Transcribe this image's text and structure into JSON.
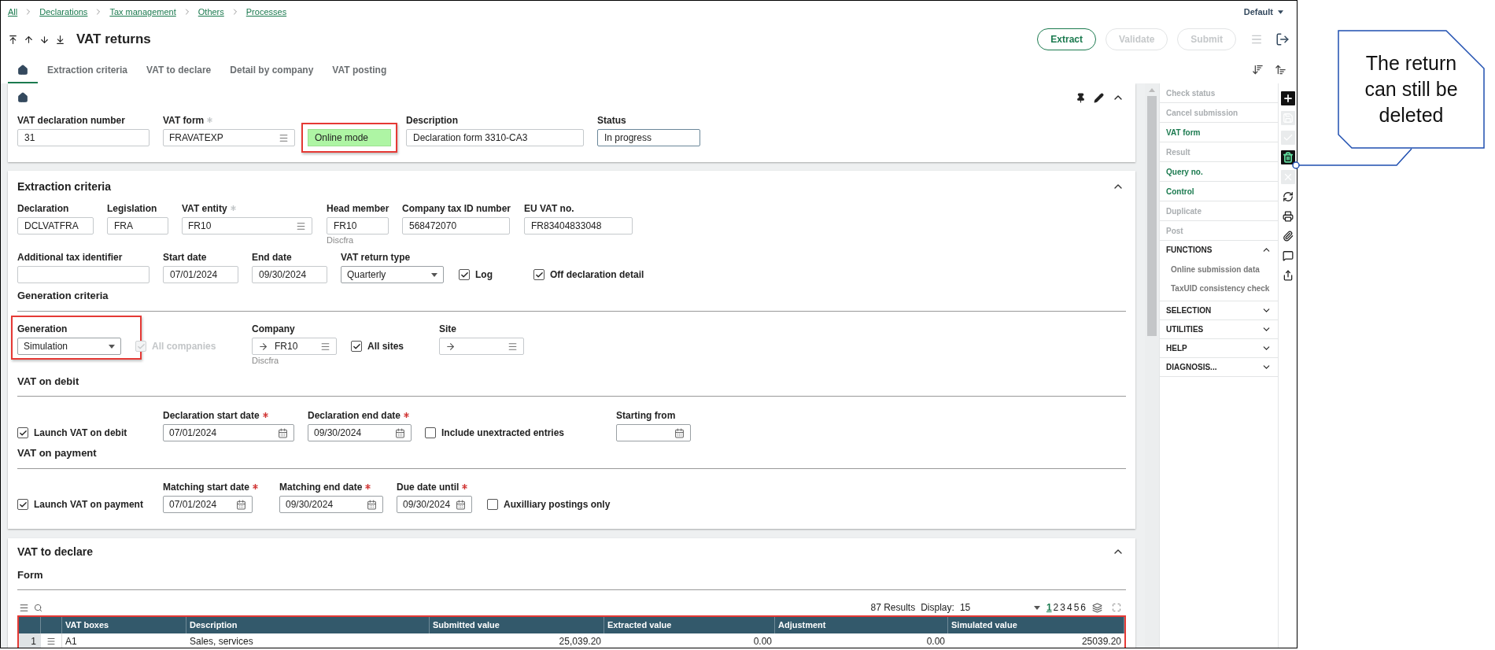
{
  "breadcrumb": [
    "All",
    "Declarations",
    "Tax management",
    "Others",
    "Processes"
  ],
  "view_selector": "Default",
  "title": "VAT returns",
  "actions": [
    {
      "label": "Extract",
      "disabled": false
    },
    {
      "label": "Validate",
      "disabled": true
    },
    {
      "label": "Submit",
      "disabled": true
    }
  ],
  "tabs": [
    {
      "kind": "home",
      "selected": true
    },
    {
      "kind": "text",
      "label": "Extraction criteria",
      "selected": false
    },
    {
      "kind": "text",
      "label": "VAT to declare",
      "selected": false
    },
    {
      "kind": "text",
      "label": "Detail by company",
      "selected": false
    },
    {
      "kind": "text",
      "label": "VAT posting",
      "selected": false
    }
  ],
  "header_fields": [
    {
      "kind": "text",
      "label": "VAT declaration number",
      "value": "31"
    },
    {
      "kind": "lookup",
      "label": "VAT form",
      "required": true,
      "star_muted": true,
      "value": "FRAVATEXP"
    },
    {
      "kind": "badge",
      "value": "Online mode",
      "highlighted": true
    },
    {
      "kind": "text",
      "label": "Description",
      "value": "Declaration form 3310-CA3"
    },
    {
      "kind": "status",
      "label": "Status",
      "value": "In progress"
    }
  ],
  "extraction": {
    "title": "Extraction criteria",
    "rows": [
      {
        "fields": [
          {
            "kind": "text",
            "label": "Declaration",
            "value": "DCLVATFRA"
          },
          {
            "kind": "text",
            "label": "Legislation",
            "value": "FRA"
          },
          {
            "kind": "lookup",
            "label": "VAT entity",
            "required": true,
            "star_muted": true,
            "value": "FR10"
          },
          {
            "kind": "text",
            "label": "Head member",
            "value": "FR10",
            "sub": "Discfra"
          },
          {
            "kind": "text",
            "label": "Company tax ID number",
            "value": "568472070"
          },
          {
            "kind": "text",
            "label": "EU VAT no.",
            "value": "FR83404833048"
          }
        ]
      },
      {
        "fields": [
          {
            "kind": "text",
            "label": "Additional tax identifier"
          },
          {
            "kind": "text",
            "label": "Start date",
            "value": "07/01/2024"
          },
          {
            "kind": "text",
            "label": "End date",
            "value": "09/30/2024"
          },
          {
            "kind": "select",
            "label": "VAT return type",
            "value": "Quarterly"
          },
          {
            "kind": "checkbox",
            "label": "Log",
            "checked": true,
            "disabled": false
          },
          {
            "kind": "checkbox",
            "label": "Off declaration detail",
            "checked": true,
            "disabled": false
          }
        ]
      }
    ],
    "sections": [
      {
        "title": "Generation criteria",
        "fields": [
          {
            "kind": "select",
            "label": "Generation",
            "value": "Simulation",
            "highlighted": true
          },
          {
            "kind": "checkbox",
            "label": "All companies",
            "checked": true,
            "disabled": true
          },
          {
            "kind": "lookup",
            "label": "Company",
            "arrow": true,
            "value": "FR10",
            "sub": "Discfra"
          },
          {
            "kind": "checkbox",
            "label": "All sites",
            "checked": true,
            "disabled": false
          },
          {
            "kind": "lookup",
            "label": "Site",
            "arrow": true
          }
        ]
      },
      {
        "title": "VAT on debit",
        "fields": [
          {
            "kind": "checkbox",
            "label": "Launch VAT on debit",
            "checked": true,
            "disabled": false
          },
          {
            "kind": "date",
            "label": "Declaration start date",
            "required": true,
            "star_muted": false,
            "value": "07/01/2024"
          },
          {
            "kind": "date",
            "label": "Declaration end date",
            "required": true,
            "star_muted": false,
            "value": "09/30/2024"
          },
          {
            "kind": "checkbox",
            "label": "Include unextracted entries",
            "checked": false,
            "disabled": false
          },
          {
            "kind": "date",
            "label": "Starting from"
          }
        ]
      },
      {
        "title": "VAT on payment",
        "fields": [
          {
            "kind": "checkbox",
            "label": "Launch VAT on payment",
            "checked": true,
            "disabled": false
          },
          {
            "kind": "date",
            "label": "Matching start date",
            "required": true,
            "star_muted": false,
            "value": "07/01/2024"
          },
          {
            "kind": "date",
            "label": "Matching end date",
            "required": true,
            "star_muted": false,
            "value": "09/30/2024"
          },
          {
            "kind": "date",
            "label": "Due date until",
            "required": true,
            "star_muted": false,
            "value": "09/30/2024"
          },
          {
            "kind": "checkbox",
            "label": "Auxilliary postings only",
            "checked": false,
            "disabled": false
          }
        ]
      }
    ]
  },
  "vat_to_declare": {
    "title": "VAT to declare",
    "subtitle": "Form",
    "results": "87 Results",
    "display_label": "Display:",
    "display_value": "15",
    "pages": [
      {
        "label": "1",
        "selected": true
      },
      {
        "label": "2",
        "selected": false
      },
      {
        "label": "3",
        "selected": false
      },
      {
        "label": "4",
        "selected": false
      },
      {
        "label": "5",
        "selected": false
      },
      {
        "label": "6",
        "selected": false
      }
    ],
    "table": {
      "highlighted": true,
      "columns": [
        "VAT boxes",
        "Description",
        "Submitted value",
        "Extracted value",
        "Adjustment",
        "Simulated value"
      ],
      "rows": [
        {
          "number": "1",
          "cells": [
            "A1",
            "Sales, services",
            "25,039.20",
            "0.00",
            "0.00",
            "25039.20"
          ]
        }
      ]
    }
  },
  "sidebar": {
    "actions": [
      {
        "label": "Check status",
        "disabled": true
      },
      {
        "label": "Cancel submission",
        "disabled": true
      },
      {
        "label": "VAT form",
        "disabled": false
      },
      {
        "label": "Result",
        "disabled": true
      },
      {
        "label": "Query no.",
        "disabled": false
      },
      {
        "label": "Control",
        "disabled": false
      },
      {
        "label": "Duplicate",
        "disabled": true
      },
      {
        "label": "Post",
        "disabled": true
      }
    ],
    "sections": [
      {
        "label": "FUNCTIONS",
        "expanded": true,
        "children": [
          {
            "label": "Online submission data"
          },
          {
            "label": "TaxUID consistency check"
          }
        ]
      },
      {
        "label": "SELECTION",
        "expanded": false
      },
      {
        "label": "UTILITIES",
        "expanded": false
      },
      {
        "label": "HELP",
        "expanded": false
      },
      {
        "label": "DIAGNOSIS...",
        "expanded": false
      }
    ]
  },
  "side_tools": [
    {
      "kind": "plus",
      "filled": true,
      "disabled": false,
      "highlighted": false
    },
    {
      "kind": "save",
      "disabled": true
    },
    {
      "kind": "check",
      "disabled": true
    },
    {
      "kind": "trash",
      "filled": true,
      "disabled": false,
      "highlighted": true
    },
    {
      "kind": "close",
      "disabled": true
    },
    {
      "kind": "refresh",
      "filled": false,
      "disabled": false,
      "highlighted": false
    },
    {
      "kind": "print",
      "filled": false,
      "disabled": false,
      "highlighted": false
    },
    {
      "kind": "attach",
      "filled": false,
      "disabled": false,
      "highlighted": false
    },
    {
      "kind": "comment",
      "filled": false,
      "disabled": false,
      "highlighted": false
    },
    {
      "kind": "export",
      "filled": false,
      "disabled": false,
      "highlighted": false
    }
  ],
  "annotation": {
    "text": "The return can still be deleted"
  }
}
